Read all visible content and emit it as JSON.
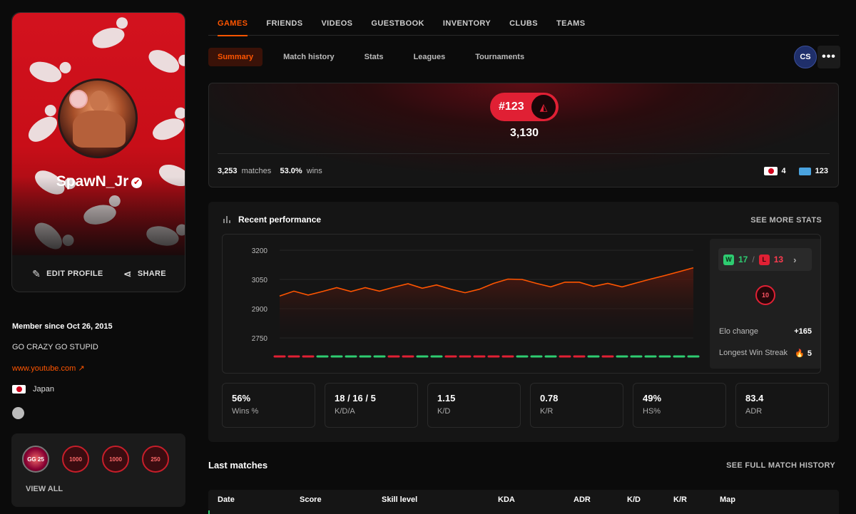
{
  "profile": {
    "nickname": "SpawN_Jr",
    "verified_icon": "verified-check-icon",
    "actions": {
      "edit": "EDIT PROFILE",
      "share": "SHARE"
    },
    "member_since": "Member since Oct 26, 2015",
    "bio": "GO CRAZY GO STUPID",
    "link": "www.youtube.com",
    "country": "Japan",
    "badges": [
      {
        "text": "GG 25"
      },
      {
        "text": "1000"
      },
      {
        "text": "1000"
      },
      {
        "text": "250"
      }
    ],
    "view_all": "VIEW ALL"
  },
  "top_nav": [
    "GAMES",
    "FRIENDS",
    "VIDEOS",
    "GUESTBOOK",
    "INVENTORY",
    "CLUBS",
    "TEAMS"
  ],
  "sub_nav": [
    "Summary",
    "Match history",
    "Stats",
    "Leagues",
    "Tournaments"
  ],
  "game_logo": "CS",
  "more_label": "•••",
  "rank": {
    "position": "#123",
    "elo": "3,130",
    "matches_value": "3,253",
    "matches_label": "matches",
    "wins_value": "53.0%",
    "wins_label": "wins",
    "country_rank": "4",
    "region_rank": "123"
  },
  "performance": {
    "title": "Recent performance",
    "see_more": "SEE MORE STATS",
    "wins": "17",
    "losses": "13",
    "w_letter": "W",
    "l_letter": "L",
    "level": "10",
    "elo_change_label": "Elo change",
    "elo_change_value": "+165",
    "streak_label": "Longest Win Streak",
    "streak_value": "5",
    "colors": {
      "line": "#ff5500",
      "win": "#2ecc71",
      "loss": "#e02034"
    }
  },
  "chart_data": {
    "type": "line",
    "yticks": [
      3200,
      3050,
      2900,
      2750
    ],
    "ylim": [
      2750,
      3200
    ],
    "values": [
      2965,
      2990,
      2970,
      2988,
      3008,
      2988,
      3008,
      2990,
      3010,
      3028,
      3005,
      3022,
      3000,
      2982,
      3000,
      3030,
      3052,
      3050,
      3030,
      3012,
      3036,
      3036,
      3014,
      3030,
      3012,
      3032,
      3052,
      3070,
      3090,
      3110
    ],
    "results": [
      "L",
      "L",
      "L",
      "W",
      "W",
      "W",
      "W",
      "W",
      "L",
      "L",
      "W",
      "W",
      "L",
      "L",
      "L",
      "L",
      "L",
      "W",
      "W",
      "W",
      "L",
      "L",
      "W",
      "L",
      "W",
      "W",
      "W",
      "W",
      "W",
      "W"
    ]
  },
  "stats": [
    {
      "value": "56%",
      "label": "Wins %"
    },
    {
      "value": "18 / 16 / 5",
      "label": "K/D/A"
    },
    {
      "value": "1.15",
      "label": "K/D"
    },
    {
      "value": "0.78",
      "label": "K/R"
    },
    {
      "value": "49%",
      "label": "HS%"
    },
    {
      "value": "83.4",
      "label": "ADR"
    }
  ],
  "last_matches": {
    "title": "Last matches",
    "see_full": "SEE FULL MATCH HISTORY",
    "columns": [
      "Date",
      "Score",
      "Skill level",
      "KDA",
      "ADR",
      "K/D",
      "K/R",
      "Map"
    ]
  }
}
